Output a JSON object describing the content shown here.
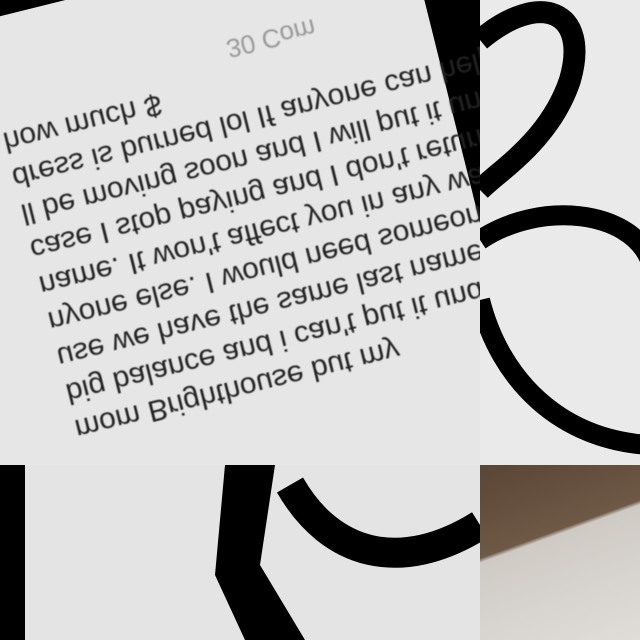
{
  "post": {
    "lines": [
      "mom Brighthouse but my",
      "big balance and i can't put it under my",
      "use we have the same last name and I",
      "nyone else. I would need someone's id",
      "name. It won't affect you in any way. The",
      "case I stop paying and I don't return",
      "ll be moving soon and I will put it unde",
      "dress is burned lol If anyone can help",
      "how much $"
    ],
    "comments": "30 Com"
  }
}
